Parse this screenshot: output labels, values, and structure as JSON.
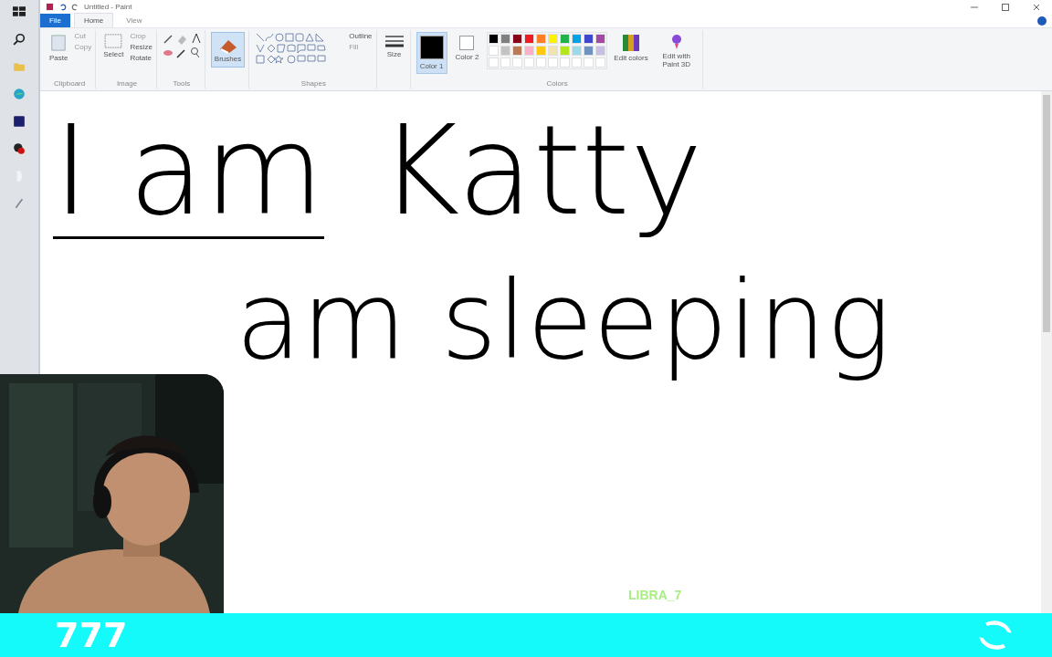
{
  "window": {
    "title": "Untitled - Paint"
  },
  "tabs": [
    {
      "label": "File",
      "kind": "file",
      "selected": false
    },
    {
      "label": "Home",
      "kind": "tab",
      "selected": true
    },
    {
      "label": "View",
      "kind": "tab",
      "selected": false
    }
  ],
  "ribbon": {
    "clipboard": {
      "paste": "Paste",
      "cut": "Cut",
      "copy": "Copy",
      "label": "Clipboard"
    },
    "image": {
      "select": "Select",
      "crop": "Crop",
      "resize": "Resize",
      "rotate": "Rotate",
      "label": "Image"
    },
    "tools": {
      "label": "Tools"
    },
    "brushes": {
      "label": "Brushes",
      "selected": true
    },
    "shapes": {
      "outline": "Outline",
      "fill": "Fill",
      "label": "Shapes"
    },
    "size": "Size",
    "color1": {
      "label": "Color 1",
      "color": "#000000",
      "selected": true
    },
    "color2": {
      "label": "Color 2",
      "color": "#ffffff",
      "selected": false
    },
    "palette": [
      {
        "color": "#000000"
      },
      {
        "color": "#7f7f7f"
      },
      {
        "color": "#880015"
      },
      {
        "color": "#ed1c24"
      },
      {
        "color": "#ff7f27"
      },
      {
        "color": "#fff200"
      },
      {
        "color": "#22b14c"
      },
      {
        "color": "#00a2e8"
      },
      {
        "color": "#3f48cc"
      },
      {
        "color": "#a349a4"
      },
      {
        "color": "#ffffff"
      },
      {
        "color": "#c3c3c3"
      },
      {
        "color": "#b97a57"
      },
      {
        "color": "#ffaec9"
      },
      {
        "color": "#ffc90e"
      },
      {
        "color": "#efe4b0"
      },
      {
        "color": "#b5e61d"
      },
      {
        "color": "#99d9ea"
      },
      {
        "color": "#7092be"
      },
      {
        "color": "#c8bfe7"
      }
    ],
    "edit_colors": "Edit colors",
    "paint3d": "Edit with Paint 3D",
    "colors_label": "Colors"
  },
  "canvas": {
    "lines": [
      {
        "segments": [
          {
            "text": "I am",
            "underlined": true
          },
          {
            "text": "Katty",
            "underlined": false
          }
        ]
      },
      {
        "segments": [
          {
            "text": "am sleeping",
            "underlined": false
          }
        ]
      }
    ]
  },
  "overlay": {
    "username": "LIBRA_7"
  },
  "bottom_bar": {
    "text": "777"
  }
}
